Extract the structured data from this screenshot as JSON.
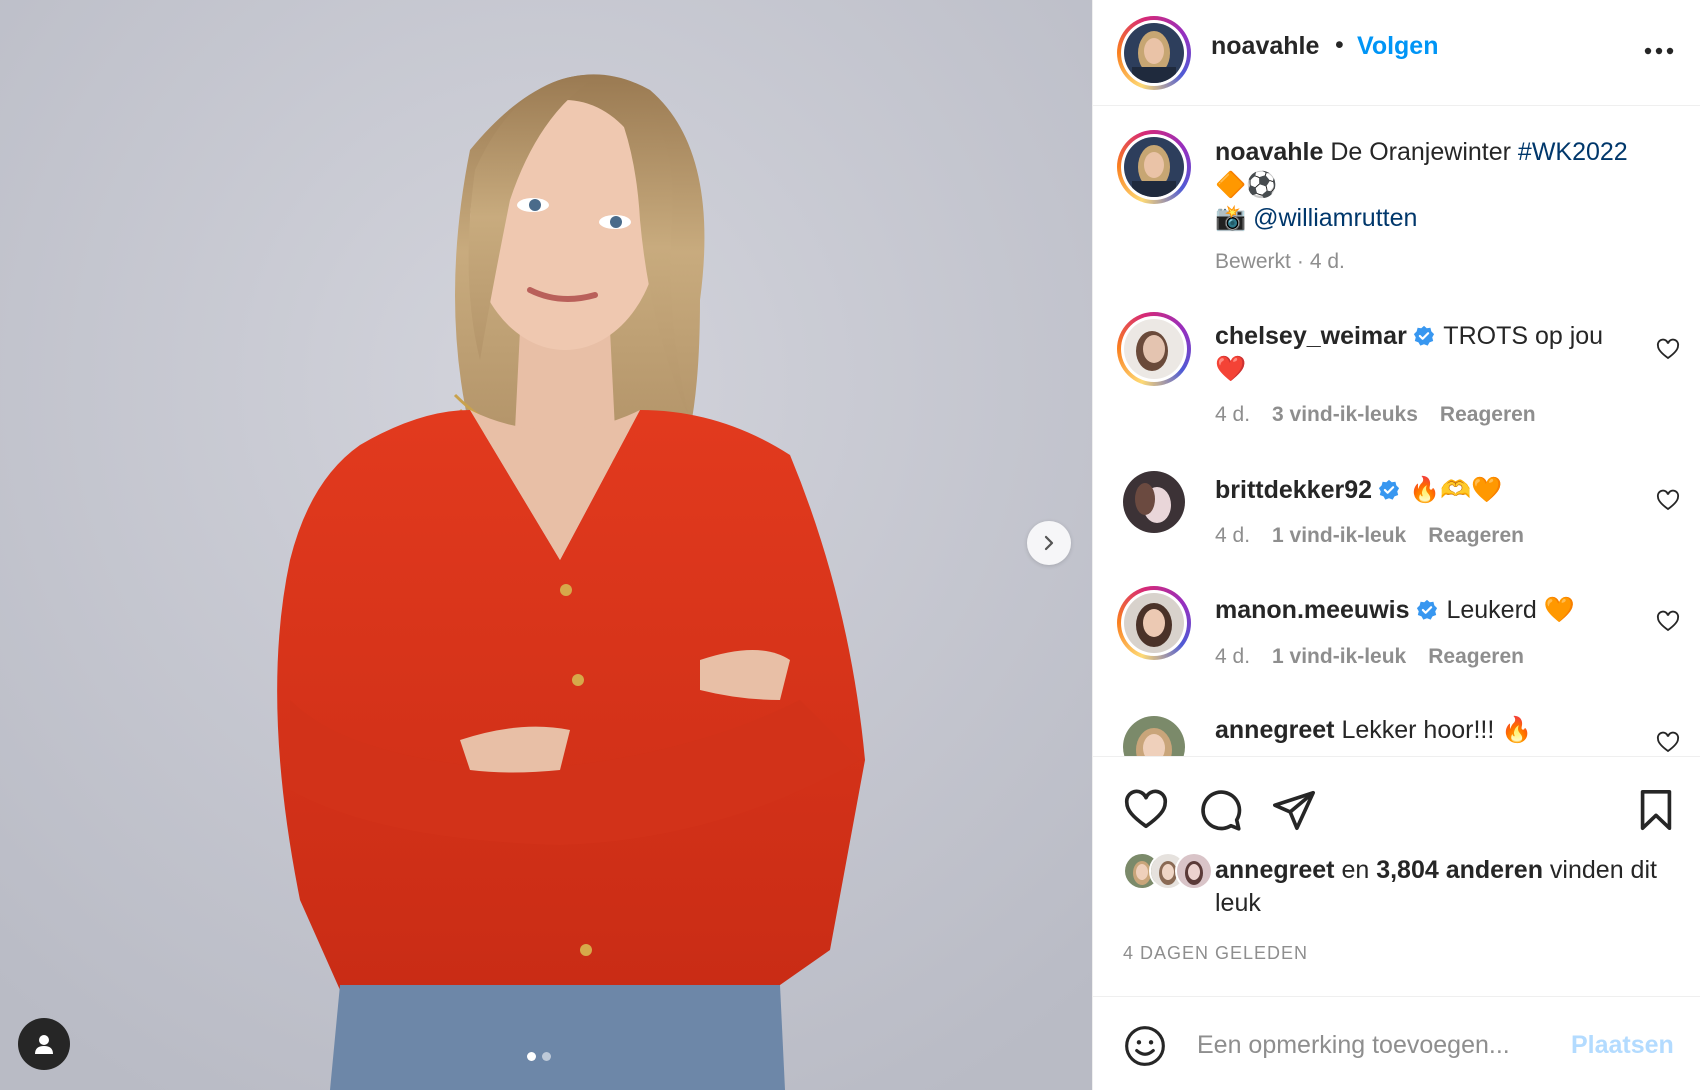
{
  "post": {
    "author": "noavahle",
    "separator": "•",
    "follow_label": "Volgen",
    "more_icon": "more-horizontal-icon",
    "carousel": {
      "slide_count": 2,
      "active_slide": 1
    }
  },
  "caption": {
    "username": "noavahle",
    "text": "De Oranjewinter",
    "hashtag": "#WK2022",
    "emojis": "🔶⚽️",
    "camera_emoji": "📸",
    "mention": "@williamrutten",
    "edited_label": "Bewerkt",
    "age": "4 d."
  },
  "comments": [
    {
      "username": "chelsey_weimar",
      "verified": true,
      "text": "TROTS op jou ❤️",
      "age": "4 d.",
      "likes": "3 vind-ik-leuks",
      "reply": "Reageren"
    },
    {
      "username": "brittdekker92",
      "verified": true,
      "text": "🔥🫶🧡",
      "age": "4 d.",
      "likes": "1 vind-ik-leuk",
      "reply": "Reageren"
    },
    {
      "username": "manon.meeuwis",
      "verified": true,
      "text": "Leukerd 🧡",
      "age": "4 d.",
      "likes": "1 vind-ik-leuk",
      "reply": "Reageren"
    },
    {
      "username": "annegreet",
      "verified": false,
      "text": "Lekker hoor!!! 🔥"
    }
  ],
  "likes": {
    "user": "annegreet",
    "connector": "en",
    "others": "3,804 anderen",
    "suffix": "vinden dit leuk"
  },
  "timestamp": "4 DAGEN GELEDEN",
  "add_comment": {
    "placeholder": "Een opmerking toevoegen...",
    "post_label": "Plaatsen"
  },
  "colors": {
    "accent": "#0095f6",
    "link": "#00376b",
    "muted": "#8e8e8e",
    "post_disabled": "#b3dbff",
    "verified": "#3897f0"
  }
}
